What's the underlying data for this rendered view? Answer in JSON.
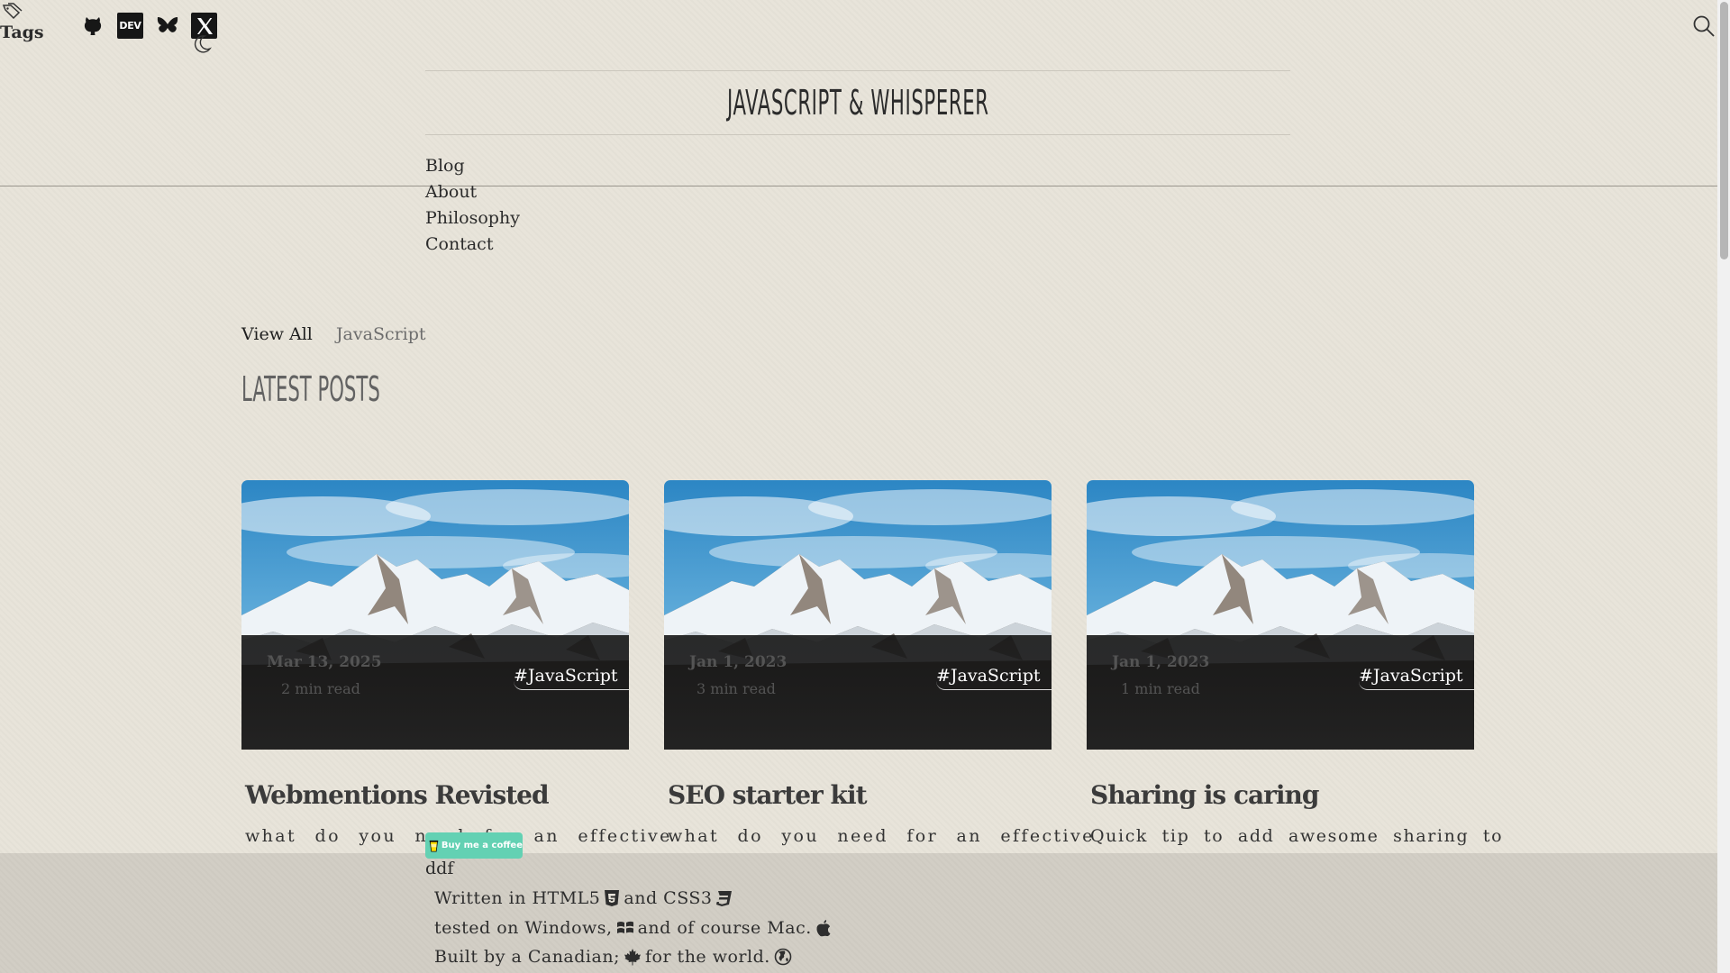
{
  "header": {
    "tags_label": "Tags",
    "social": [
      {
        "name": "github",
        "icon": "github-icon"
      },
      {
        "name": "dev",
        "icon": "dev-icon",
        "label": "DEV"
      },
      {
        "name": "bluesky",
        "icon": "butterfly-icon"
      },
      {
        "name": "x",
        "icon": "x-icon"
      }
    ],
    "theme_icon": "moon-icon",
    "search_icon": "search-icon"
  },
  "site": {
    "title": "JAVASCRIPT & WHISPERER"
  },
  "nav": {
    "items": [
      "Blog",
      "About",
      "Philosophy",
      "Contact"
    ]
  },
  "filters": {
    "all": "View All",
    "javascript": "JavaScript"
  },
  "section": {
    "title": "LATEST POSTS"
  },
  "posts": [
    {
      "date": "Mar 13, 2025",
      "read": "2 min read",
      "tag": "#JavaScript",
      "title": "Webmentions Revisted",
      "excerpt": "what do you need for an effective"
    },
    {
      "date": "Jan 1, 2023",
      "read": "3 min read",
      "tag": "#JavaScript",
      "title": "SEO starter kit",
      "excerpt": "what do you need for an effective"
    },
    {
      "date": "Jan 1, 2023",
      "read": "1 min read",
      "tag": "#JavaScript",
      "title": "Sharing is caring",
      "excerpt": "Quick tip to add awesome sharing to"
    }
  ],
  "coffee": {
    "label": "Buy me a coffee",
    "color": "#63d1b3"
  },
  "footer": {
    "ddf": "ddf",
    "line1_a": "Written in HTML5",
    "line1_b": "and CSS3",
    "line2_a": "tested on Windows,",
    "line2_b": "and of course Mac.",
    "line3_a": "Built by a Canadian;",
    "line3_b": "for the world."
  }
}
